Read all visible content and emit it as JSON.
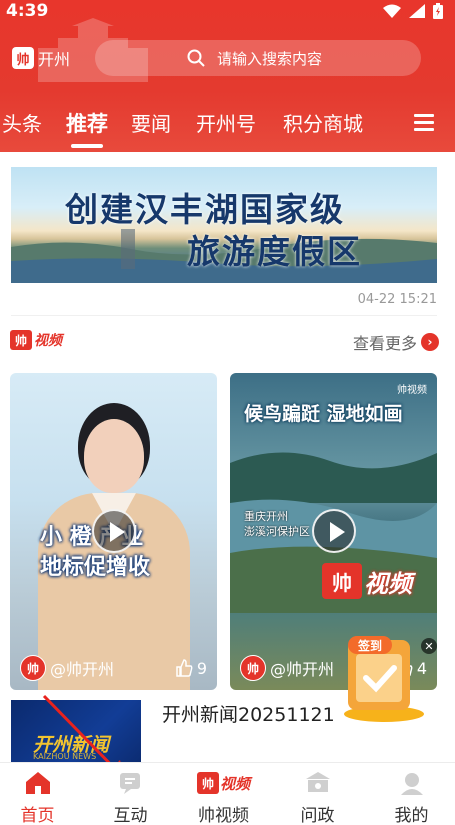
{
  "status_bar": {
    "time": "4:39"
  },
  "header": {
    "logo_mark": "帅",
    "location": "开州",
    "search_placeholder": "请输入搜索内容"
  },
  "tabs": [
    {
      "label": "头条"
    },
    {
      "label": "推荐",
      "active": true
    },
    {
      "label": "要闻"
    },
    {
      "label": "开州号"
    },
    {
      "label": "积分商城"
    }
  ],
  "banner": {
    "line1": "创建汉丰湖国家级",
    "line2": "旅游度假区",
    "timestamp": "04-22 15:21"
  },
  "section": {
    "logo_mark": "帅",
    "logo_text": "视频",
    "more_label": "查看更多"
  },
  "videos": [
    {
      "overlay_line1": "小 橙  产业",
      "overlay_line2": "地标促增收",
      "author_mark": "帅",
      "author": "@帅开州",
      "likes": "9"
    },
    {
      "title": "候鸟蹁跹 湿地如画",
      "corner_label": "帅视频",
      "place_line1": "重庆开州",
      "place_line2": "澎溪河保护区",
      "watermark_mark": "帅",
      "watermark_text": "视频",
      "author_mark": "帅",
      "author": "@帅开州",
      "likes": "4"
    }
  ],
  "checkin": {
    "label": "签到"
  },
  "news": {
    "title": "开州新闻20251121",
    "thumb_title": "开州新闻",
    "thumb_sub": "KAIZHOU NEWS"
  },
  "bottom_nav": [
    {
      "label": "首页",
      "active": true,
      "icon": "home-icon"
    },
    {
      "label": "互动",
      "icon": "chat-icon"
    },
    {
      "label": "帅视频",
      "icon": "shuai-video-logo",
      "mark": "帅",
      "text": "视频"
    },
    {
      "label": "问政",
      "icon": "government-icon"
    },
    {
      "label": "我的",
      "icon": "user-icon"
    }
  ],
  "colors": {
    "brand_red": "#e4342a",
    "annotation_red": "#e8231e"
  }
}
